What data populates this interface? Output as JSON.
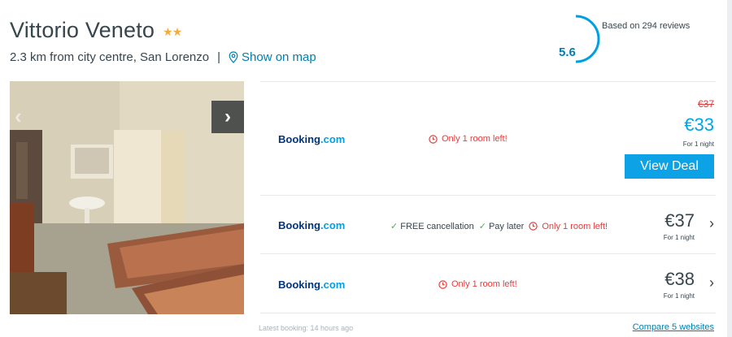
{
  "hotel": {
    "name": "Vittorio Veneto",
    "stars": "★★",
    "distance": "2.3 km from city centre, San Lorenzo",
    "separator": "|",
    "map_link": "Show on map"
  },
  "rating": {
    "score": "5.6",
    "reviews": "Based on 294 reviews",
    "score_fraction": 0.56,
    "color": "#009fe3"
  },
  "gallery": {
    "prev_icon": "chevron-left-icon",
    "next_icon": "chevron-right-icon",
    "prev_glyph": "‹",
    "next_glyph": "›"
  },
  "deals": [
    {
      "provider_main": "Booking",
      "provider_suffix": ".com",
      "alert": "Only 1 room left!",
      "old_price": "€37",
      "price": "€33",
      "per_night": "For 1 night",
      "cta": "View Deal"
    },
    {
      "provider_main": "Booking",
      "provider_suffix": ".com",
      "perk_1": "FREE cancellation",
      "perk_2": "Pay later",
      "alert": "Only 1 room left!",
      "price": "€37",
      "per_night": "For 1 night",
      "chevron": "›"
    },
    {
      "provider_main": "Booking",
      "provider_suffix": ".com",
      "alert": "Only 1 room left!",
      "price": "€38",
      "per_night": "For 1 night",
      "chevron": "›"
    }
  ],
  "footer": {
    "latest_booking": "Latest booking: 14 hours ago",
    "compare": "Compare 5 websites"
  },
  "colors": {
    "accent": "#00a5e5",
    "alert": "#e03e3e",
    "cta": "#0da1e6",
    "booking_navy": "#003580",
    "star": "#f6ab3f"
  }
}
